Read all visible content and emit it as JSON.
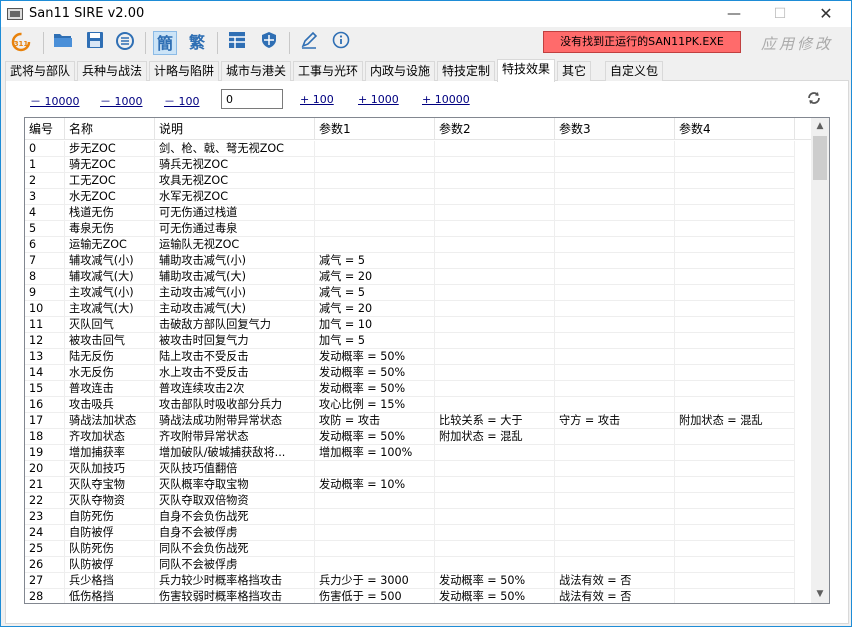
{
  "window": {
    "title": "San11 SIRE v2.00"
  },
  "toolbar": {
    "icons": [
      "refresh-311-icon",
      "open-folder-icon",
      "save-icon",
      "list-icon",
      "simplified-chinese-icon",
      "traditional-chinese-icon",
      "grid-icon",
      "shield-icon",
      "pen-icon",
      "info-icon"
    ],
    "simplified_label": "簡",
    "traditional_label": "繁",
    "status_text": "没有找到正运行的SAN11PK.EXE",
    "status_color": "#ff6b6b",
    "brand_text": "应用修改"
  },
  "tabs": [
    "武将与部队",
    "兵种与战法",
    "计略与陷阱",
    "城市与港关",
    "工事与光环",
    "内政与设施",
    "特技定制",
    "特技效果",
    "其它",
    "自定义包"
  ],
  "active_tab": "特技效果",
  "stepper": {
    "minus_10000": "－ 10000",
    "minus_1000": "－ 1000",
    "minus_100": "－ 100",
    "value": "0",
    "plus_100": "+ 100",
    "plus_1000": "+ 1000",
    "plus_10000": "+ 10000"
  },
  "grid": {
    "columns": [
      "编号",
      "名称",
      "说明",
      "参数1",
      "参数2",
      "参数3",
      "参数4"
    ],
    "rows": [
      [
        "0",
        "步无ZOC",
        "剑、枪、戟、弩无视ZOC",
        "",
        "",
        "",
        ""
      ],
      [
        "1",
        "骑无ZOC",
        "骑兵无视ZOC",
        "",
        "",
        "",
        ""
      ],
      [
        "2",
        "工无ZOC",
        "攻具无视ZOC",
        "",
        "",
        "",
        ""
      ],
      [
        "3",
        "水无ZOC",
        "水军无视ZOC",
        "",
        "",
        "",
        ""
      ],
      [
        "4",
        "栈道无伤",
        "可无伤通过栈道",
        "",
        "",
        "",
        ""
      ],
      [
        "5",
        "毒泉无伤",
        "可无伤通过毒泉",
        "",
        "",
        "",
        ""
      ],
      [
        "6",
        "运输无ZOC",
        "运输队无视ZOC",
        "",
        "",
        "",
        ""
      ],
      [
        "7",
        "辅攻减气(小)",
        "辅助攻击减气(小)",
        "减气 = 5",
        "",
        "",
        ""
      ],
      [
        "8",
        "辅攻减气(大)",
        "辅助攻击减气(大)",
        "减气 = 20",
        "",
        "",
        ""
      ],
      [
        "9",
        "主攻减气(小)",
        "主动攻击减气(小)",
        "减气 = 5",
        "",
        "",
        ""
      ],
      [
        "10",
        "主攻减气(大)",
        "主动攻击减气(大)",
        "减气 = 20",
        "",
        "",
        ""
      ],
      [
        "11",
        "灭队回气",
        "击破敌方部队回复气力",
        "加气 = 10",
        "",
        "",
        ""
      ],
      [
        "12",
        "被攻击回气",
        "被攻击时回复气力",
        "加气 = 5",
        "",
        "",
        ""
      ],
      [
        "13",
        "陆无反伤",
        "陆上攻击不受反击",
        "发动概率 = 50%",
        "",
        "",
        ""
      ],
      [
        "14",
        "水无反伤",
        "水上攻击不受反击",
        "发动概率 = 50%",
        "",
        "",
        ""
      ],
      [
        "15",
        "普攻连击",
        "普攻连续攻击2次",
        "发动概率 = 50%",
        "",
        "",
        ""
      ],
      [
        "16",
        "攻击吸兵",
        "攻击部队时吸收部分兵力",
        "攻心比例 = 15%",
        "",
        "",
        ""
      ],
      [
        "17",
        "骑战法加状态",
        "骑战法成功附带异常状态",
        "攻防 = 攻击",
        "比较关系 = 大于",
        "守方 = 攻击",
        "附加状态 = 混乱"
      ],
      [
        "18",
        "齐攻加状态",
        "齐攻附带异常状态",
        "发动概率 = 50%",
        "附加状态 = 混乱",
        "",
        ""
      ],
      [
        "19",
        "增加捕获率",
        "增加破队/破城捕获敌将...",
        "增加概率 = 100%",
        "",
        "",
        ""
      ],
      [
        "20",
        "灭队加技巧",
        "灭队技巧值翻倍",
        "",
        "",
        "",
        ""
      ],
      [
        "21",
        "灭队夺宝物",
        "灭队概率夺取宝物",
        "发动概率 = 10%",
        "",
        "",
        ""
      ],
      [
        "22",
        "灭队夺物资",
        "灭队夺取双倍物资",
        "",
        "",
        "",
        ""
      ],
      [
        "23",
        "自防死伤",
        "自身不会负伤战死",
        "",
        "",
        "",
        ""
      ],
      [
        "24",
        "自防被俘",
        "自身不会被俘虏",
        "",
        "",
        "",
        ""
      ],
      [
        "25",
        "队防死伤",
        "同队不会负伤战死",
        "",
        "",
        "",
        ""
      ],
      [
        "26",
        "队防被俘",
        "同队不会被俘虏",
        "",
        "",
        "",
        ""
      ],
      [
        "27",
        "兵少格挡",
        "兵力较少时概率格挡攻击",
        "兵力少于 = 3000",
        "发动概率 = 50%",
        "战法有效 = 否",
        ""
      ],
      [
        "28",
        "低伤格挡",
        "伤害较弱时概率格挡攻击",
        "伤害低于 = 500",
        "发动概率 = 50%",
        "战法有效 = 否",
        ""
      ]
    ]
  }
}
